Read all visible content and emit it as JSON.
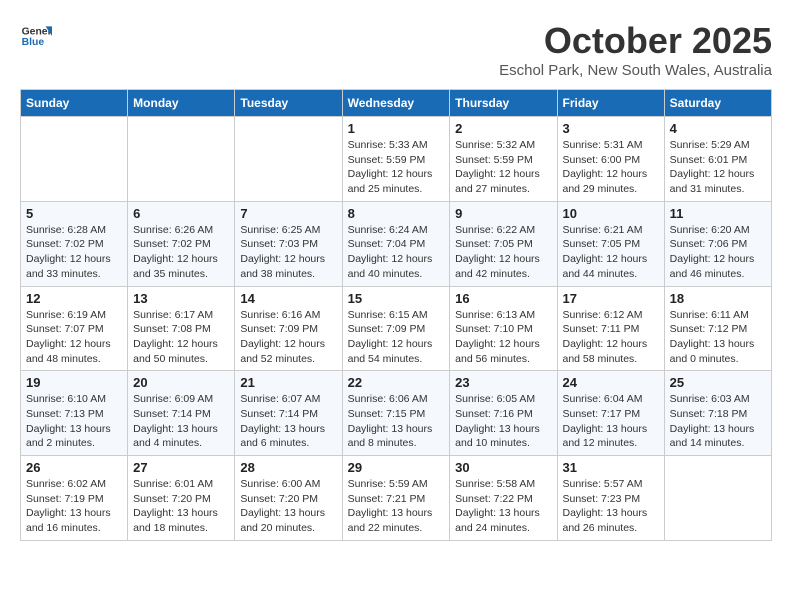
{
  "logo": {
    "line1": "General",
    "line2": "Blue"
  },
  "title": "October 2025",
  "location": "Eschol Park, New South Wales, Australia",
  "days_header": [
    "Sunday",
    "Monday",
    "Tuesday",
    "Wednesday",
    "Thursday",
    "Friday",
    "Saturday"
  ],
  "weeks": [
    [
      {
        "day": "",
        "info": ""
      },
      {
        "day": "",
        "info": ""
      },
      {
        "day": "",
        "info": ""
      },
      {
        "day": "1",
        "info": "Sunrise: 5:33 AM\nSunset: 5:59 PM\nDaylight: 12 hours\nand 25 minutes."
      },
      {
        "day": "2",
        "info": "Sunrise: 5:32 AM\nSunset: 5:59 PM\nDaylight: 12 hours\nand 27 minutes."
      },
      {
        "day": "3",
        "info": "Sunrise: 5:31 AM\nSunset: 6:00 PM\nDaylight: 12 hours\nand 29 minutes."
      },
      {
        "day": "4",
        "info": "Sunrise: 5:29 AM\nSunset: 6:01 PM\nDaylight: 12 hours\nand 31 minutes."
      }
    ],
    [
      {
        "day": "5",
        "info": "Sunrise: 6:28 AM\nSunset: 7:02 PM\nDaylight: 12 hours\nand 33 minutes."
      },
      {
        "day": "6",
        "info": "Sunrise: 6:26 AM\nSunset: 7:02 PM\nDaylight: 12 hours\nand 35 minutes."
      },
      {
        "day": "7",
        "info": "Sunrise: 6:25 AM\nSunset: 7:03 PM\nDaylight: 12 hours\nand 38 minutes."
      },
      {
        "day": "8",
        "info": "Sunrise: 6:24 AM\nSunset: 7:04 PM\nDaylight: 12 hours\nand 40 minutes."
      },
      {
        "day": "9",
        "info": "Sunrise: 6:22 AM\nSunset: 7:05 PM\nDaylight: 12 hours\nand 42 minutes."
      },
      {
        "day": "10",
        "info": "Sunrise: 6:21 AM\nSunset: 7:05 PM\nDaylight: 12 hours\nand 44 minutes."
      },
      {
        "day": "11",
        "info": "Sunrise: 6:20 AM\nSunset: 7:06 PM\nDaylight: 12 hours\nand 46 minutes."
      }
    ],
    [
      {
        "day": "12",
        "info": "Sunrise: 6:19 AM\nSunset: 7:07 PM\nDaylight: 12 hours\nand 48 minutes."
      },
      {
        "day": "13",
        "info": "Sunrise: 6:17 AM\nSunset: 7:08 PM\nDaylight: 12 hours\nand 50 minutes."
      },
      {
        "day": "14",
        "info": "Sunrise: 6:16 AM\nSunset: 7:09 PM\nDaylight: 12 hours\nand 52 minutes."
      },
      {
        "day": "15",
        "info": "Sunrise: 6:15 AM\nSunset: 7:09 PM\nDaylight: 12 hours\nand 54 minutes."
      },
      {
        "day": "16",
        "info": "Sunrise: 6:13 AM\nSunset: 7:10 PM\nDaylight: 12 hours\nand 56 minutes."
      },
      {
        "day": "17",
        "info": "Sunrise: 6:12 AM\nSunset: 7:11 PM\nDaylight: 12 hours\nand 58 minutes."
      },
      {
        "day": "18",
        "info": "Sunrise: 6:11 AM\nSunset: 7:12 PM\nDaylight: 13 hours\nand 0 minutes."
      }
    ],
    [
      {
        "day": "19",
        "info": "Sunrise: 6:10 AM\nSunset: 7:13 PM\nDaylight: 13 hours\nand 2 minutes."
      },
      {
        "day": "20",
        "info": "Sunrise: 6:09 AM\nSunset: 7:14 PM\nDaylight: 13 hours\nand 4 minutes."
      },
      {
        "day": "21",
        "info": "Sunrise: 6:07 AM\nSunset: 7:14 PM\nDaylight: 13 hours\nand 6 minutes."
      },
      {
        "day": "22",
        "info": "Sunrise: 6:06 AM\nSunset: 7:15 PM\nDaylight: 13 hours\nand 8 minutes."
      },
      {
        "day": "23",
        "info": "Sunrise: 6:05 AM\nSunset: 7:16 PM\nDaylight: 13 hours\nand 10 minutes."
      },
      {
        "day": "24",
        "info": "Sunrise: 6:04 AM\nSunset: 7:17 PM\nDaylight: 13 hours\nand 12 minutes."
      },
      {
        "day": "25",
        "info": "Sunrise: 6:03 AM\nSunset: 7:18 PM\nDaylight: 13 hours\nand 14 minutes."
      }
    ],
    [
      {
        "day": "26",
        "info": "Sunrise: 6:02 AM\nSunset: 7:19 PM\nDaylight: 13 hours\nand 16 minutes."
      },
      {
        "day": "27",
        "info": "Sunrise: 6:01 AM\nSunset: 7:20 PM\nDaylight: 13 hours\nand 18 minutes."
      },
      {
        "day": "28",
        "info": "Sunrise: 6:00 AM\nSunset: 7:20 PM\nDaylight: 13 hours\nand 20 minutes."
      },
      {
        "day": "29",
        "info": "Sunrise: 5:59 AM\nSunset: 7:21 PM\nDaylight: 13 hours\nand 22 minutes."
      },
      {
        "day": "30",
        "info": "Sunrise: 5:58 AM\nSunset: 7:22 PM\nDaylight: 13 hours\nand 24 minutes."
      },
      {
        "day": "31",
        "info": "Sunrise: 5:57 AM\nSunset: 7:23 PM\nDaylight: 13 hours\nand 26 minutes."
      },
      {
        "day": "",
        "info": ""
      }
    ]
  ]
}
